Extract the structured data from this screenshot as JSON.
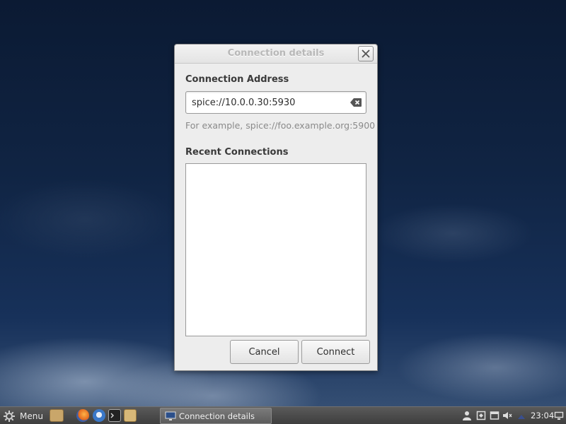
{
  "dialog": {
    "title": "Connection details",
    "address_section_label": "Connection Address",
    "address_value": "spice://10.0.0.30:5930",
    "address_hint": "For example, spice://foo.example.org:5900",
    "recent_section_label": "Recent Connections",
    "recent_items": [],
    "cancel_label": "Cancel",
    "connect_label": "Connect"
  },
  "taskbar": {
    "menu_label": "Menu",
    "launchers": [
      "files-icon",
      "firefox-icon",
      "thunderbird-icon",
      "terminal-icon",
      "folder-icon"
    ],
    "tasks": [
      {
        "label": "Connection details",
        "icon": "monitor-icon"
      }
    ],
    "tray": [
      "user-icon",
      "clipboard-icon",
      "window-icon",
      "volume-icon",
      "network-icon"
    ],
    "clock": "23:04"
  },
  "colors": {
    "desktop_top": "#0b1a33",
    "dialog_bg": "#ededed",
    "taskbar_bg": "#4a4a4a"
  }
}
